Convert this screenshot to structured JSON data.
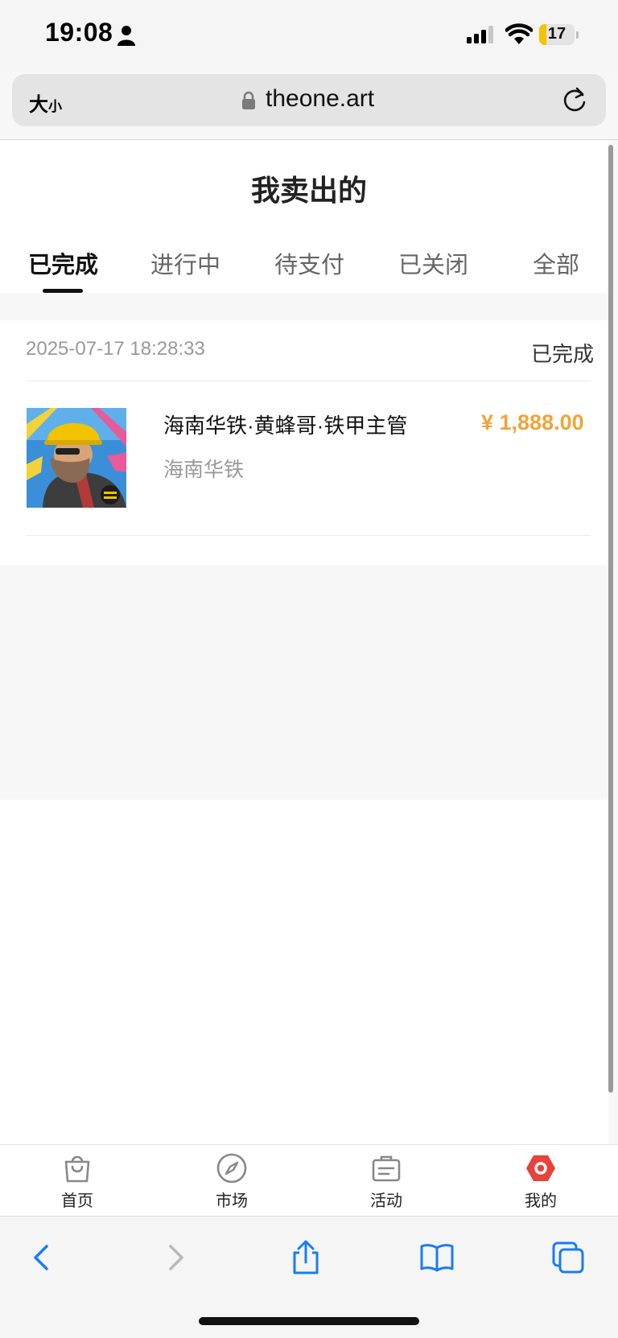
{
  "status_bar": {
    "time": "19:08",
    "battery": "17"
  },
  "browser": {
    "text_size_big": "大",
    "text_size_small": "小",
    "url": "theone.art"
  },
  "page": {
    "title": "我卖出的",
    "tabs": [
      {
        "label": "已完成",
        "active": true
      },
      {
        "label": "进行中"
      },
      {
        "label": "待支付"
      },
      {
        "label": "已关闭"
      },
      {
        "label": "全部"
      }
    ]
  },
  "order": {
    "datetime": "2025-07-17 18:28:33",
    "status": "已完成",
    "item_title": "海南华铁·黄蜂哥·铁甲主管",
    "item_brand": "海南华铁",
    "price": "¥ 1,888.00"
  },
  "bottom_nav": [
    {
      "label": "首页",
      "icon": "shopping-bag-icon"
    },
    {
      "label": "市场",
      "icon": "compass-icon"
    },
    {
      "label": "活动",
      "icon": "clipboard-icon"
    },
    {
      "label": "我的",
      "icon": "profile-hexagon-icon",
      "active": true
    }
  ],
  "colors": {
    "price": "#f0a43a",
    "active_nav": "#e8423b",
    "safari_blue": "#1a7cf2"
  }
}
